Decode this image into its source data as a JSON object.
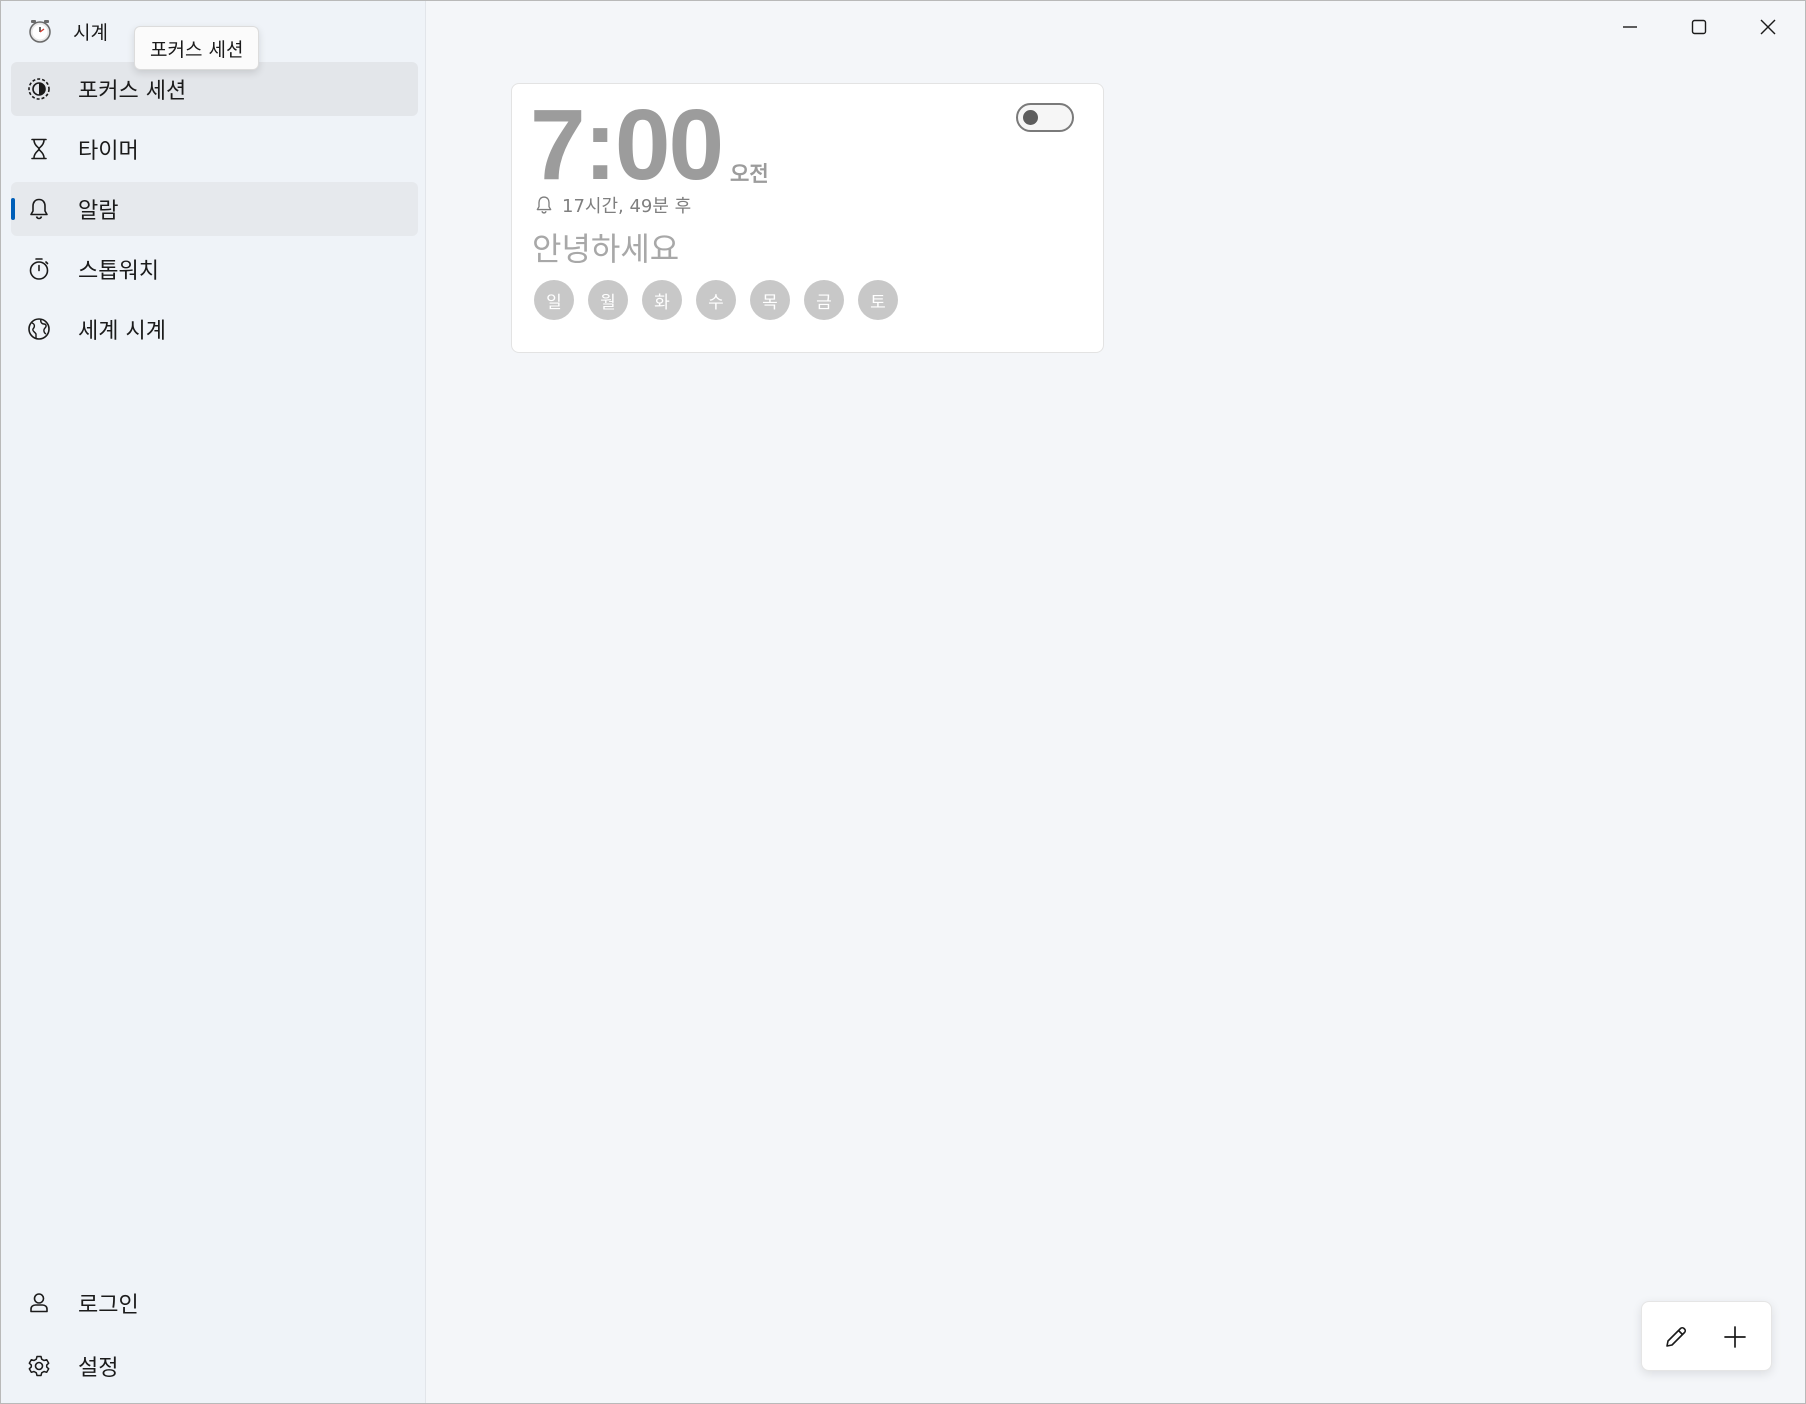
{
  "app": {
    "title": "시계",
    "icon": "clock-app-icon"
  },
  "tooltip": {
    "text": "포커스 세션"
  },
  "sidebar": {
    "items": [
      {
        "label": "포커스 세션",
        "icon": "focus-session-icon",
        "state": "hover"
      },
      {
        "label": "타이머",
        "icon": "hourglass-icon",
        "state": "normal"
      },
      {
        "label": "알람",
        "icon": "bell-icon",
        "state": "selected"
      },
      {
        "label": "스톱워치",
        "icon": "stopwatch-icon",
        "state": "normal"
      },
      {
        "label": "세계 시계",
        "icon": "globe-icon",
        "state": "normal"
      }
    ],
    "footer": [
      {
        "label": "로그인",
        "icon": "person-icon"
      },
      {
        "label": "설정",
        "icon": "gear-icon"
      }
    ]
  },
  "window_controls": [
    "minimize-icon",
    "maximize-icon",
    "close-icon"
  ],
  "alarm": {
    "time": "7:00",
    "ampm": "오전",
    "remaining": "17시간, 49분 후",
    "name": "안녕하세요",
    "enabled": false,
    "days": [
      "일",
      "월",
      "화",
      "수",
      "목",
      "금",
      "토"
    ]
  },
  "actions": [
    {
      "icon": "pencil-icon",
      "purpose": "edit"
    },
    {
      "icon": "plus-icon",
      "purpose": "add"
    }
  ],
  "colors": {
    "accent": "#005fb8",
    "day_chip": "#c8c8c8",
    "muted_text": "#9c9c9c"
  }
}
